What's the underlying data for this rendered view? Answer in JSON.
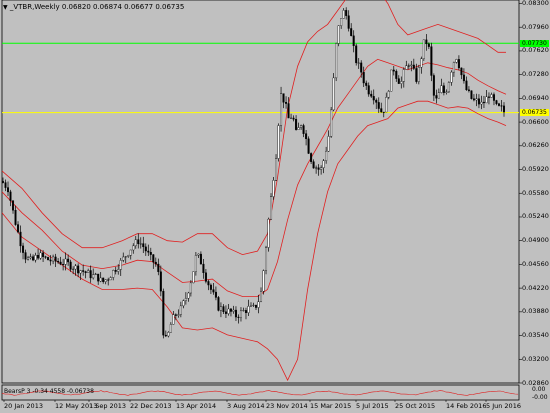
{
  "window": {
    "symbol_label": "_VTBR,Weekly",
    "ohlc": "0.06820 0.06874 0.06677 0.06735",
    "indicator_label": "BearsP 3 -0.34 4558 -0.06738",
    "indicator_ticks": [
      "0.00",
      "-0.00"
    ]
  },
  "colors": {
    "background": "#c0c0c0",
    "bollinger": "#e02020",
    "resistance_line": "#00ff00",
    "support_line": "#ffff00",
    "candles": "#000000",
    "grid": "#808080"
  },
  "price_axis": {
    "ticks": [
      "0.08300",
      "0.07960",
      "0.07620",
      "0.07280",
      "0.06940",
      "0.06600",
      "0.06260",
      "0.05920",
      "0.05580",
      "0.05240",
      "0.04900",
      "0.04560",
      "0.04220",
      "0.03880",
      "0.03540",
      "0.03200",
      "0.02860"
    ],
    "resistance_tag": "0.07730",
    "support_tag": "0.06735"
  },
  "time_axis": {
    "ticks": [
      "20 Jan 2013",
      "12 May 2013",
      "1 Sep 2013",
      "22 Dec 2013",
      "13 Apr 2014",
      "3 Aug 2014",
      "23 Nov 2014",
      "15 Mar 2015",
      "5 Jul 2015",
      "25 Oct 2015",
      "14 Feb 2016",
      "5 Jun 2016"
    ]
  },
  "chart_data": {
    "type": "candlestick",
    "title": "_VTBR,Weekly",
    "ylim": [
      0.0286,
      0.0835
    ],
    "horizontal_lines": [
      {
        "name": "resistance",
        "value": 0.0773,
        "color": "#00ff00"
      },
      {
        "name": "support",
        "value": 0.06735,
        "color": "#ffff00"
      }
    ],
    "close_path": [
      [
        0,
        0.0575
      ],
      [
        6,
        0.0565
      ],
      [
        12,
        0.0525
      ],
      [
        18,
        0.049
      ],
      [
        24,
        0.0465
      ],
      [
        30,
        0.046
      ],
      [
        36,
        0.047
      ],
      [
        42,
        0.0465
      ],
      [
        48,
        0.0462
      ],
      [
        56,
        0.046
      ],
      [
        64,
        0.0458
      ],
      [
        72,
        0.0452
      ],
      [
        80,
        0.0447
      ],
      [
        88,
        0.0441
      ],
      [
        96,
        0.0437
      ],
      [
        100,
        0.043
      ],
      [
        106,
        0.0437
      ],
      [
        112,
        0.0448
      ],
      [
        118,
        0.0458
      ],
      [
        124,
        0.047
      ],
      [
        130,
        0.0482
      ],
      [
        136,
        0.049
      ],
      [
        142,
        0.048
      ],
      [
        148,
        0.0465
      ],
      [
        154,
        0.0455
      ],
      [
        158,
        0.043
      ],
      [
        161,
        0.036
      ],
      [
        164,
        0.0345
      ],
      [
        168,
        0.0368
      ],
      [
        172,
        0.0382
      ],
      [
        178,
        0.039
      ],
      [
        184,
        0.041
      ],
      [
        190,
        0.044
      ],
      [
        194,
        0.047
      ],
      [
        198,
        0.0462
      ],
      [
        204,
        0.0435
      ],
      [
        210,
        0.0415
      ],
      [
        216,
        0.0395
      ],
      [
        222,
        0.039
      ],
      [
        228,
        0.0388
      ],
      [
        234,
        0.0382
      ],
      [
        240,
        0.0388
      ],
      [
        246,
        0.0393
      ],
      [
        252,
        0.0393
      ],
      [
        258,
        0.041
      ],
      [
        262,
        0.046
      ],
      [
        266,
        0.052
      ],
      [
        270,
        0.057
      ],
      [
        274,
        0.062
      ],
      [
        278,
        0.07
      ],
      [
        282,
        0.069
      ],
      [
        286,
        0.0665
      ],
      [
        290,
        0.067
      ],
      [
        294,
        0.064
      ],
      [
        298,
        0.066
      ],
      [
        302,
        0.0645
      ],
      [
        306,
        0.062
      ],
      [
        310,
        0.06
      ],
      [
        314,
        0.0595
      ],
      [
        318,
        0.059
      ],
      [
        322,
        0.061
      ],
      [
        326,
        0.064
      ],
      [
        330,
        0.07
      ],
      [
        334,
        0.078
      ],
      [
        338,
        0.081
      ],
      [
        342,
        0.082
      ],
      [
        346,
        0.08
      ],
      [
        350,
        0.077
      ],
      [
        354,
        0.0745
      ],
      [
        358,
        0.0735
      ],
      [
        362,
        0.0715
      ],
      [
        366,
        0.0705
      ],
      [
        370,
        0.07
      ],
      [
        374,
        0.069
      ],
      [
        378,
        0.0675
      ],
      [
        382,
        0.068
      ],
      [
        386,
        0.071
      ],
      [
        390,
        0.074
      ],
      [
        394,
        0.0725
      ],
      [
        398,
        0.0715
      ],
      [
        402,
        0.0735
      ],
      [
        406,
        0.0745
      ],
      [
        410,
        0.0735
      ],
      [
        414,
        0.072
      ],
      [
        418,
        0.075
      ],
      [
        422,
        0.078
      ],
      [
        426,
        0.0765
      ],
      [
        430,
        0.07
      ],
      [
        434,
        0.069
      ],
      [
        438,
        0.071
      ],
      [
        442,
        0.07
      ],
      [
        446,
        0.072
      ],
      [
        450,
        0.0745
      ],
      [
        454,
        0.0755
      ],
      [
        458,
        0.073
      ],
      [
        462,
        0.071
      ],
      [
        466,
        0.07
      ],
      [
        470,
        0.069
      ],
      [
        474,
        0.069
      ],
      [
        478,
        0.0685
      ],
      [
        482,
        0.069
      ],
      [
        486,
        0.07
      ],
      [
        490,
        0.069
      ],
      [
        494,
        0.068
      ],
      [
        498,
        0.068
      ],
      [
        502,
        0.0673
      ]
    ],
    "bollinger_upper": [
      [
        0,
        0.059
      ],
      [
        20,
        0.0565
      ],
      [
        40,
        0.053
      ],
      [
        60,
        0.05
      ],
      [
        80,
        0.048
      ],
      [
        100,
        0.048
      ],
      [
        120,
        0.049
      ],
      [
        135,
        0.05
      ],
      [
        150,
        0.05
      ],
      [
        165,
        0.049
      ],
      [
        180,
        0.0488
      ],
      [
        195,
        0.05
      ],
      [
        210,
        0.05
      ],
      [
        225,
        0.048
      ],
      [
        240,
        0.047
      ],
      [
        255,
        0.0475
      ],
      [
        265,
        0.05
      ],
      [
        275,
        0.058
      ],
      [
        285,
        0.068
      ],
      [
        295,
        0.074
      ],
      [
        305,
        0.0775
      ],
      [
        315,
        0.079
      ],
      [
        325,
        0.08
      ],
      [
        335,
        0.082
      ],
      [
        345,
        0.084
      ],
      [
        355,
        0.085
      ],
      [
        365,
        0.0855
      ],
      [
        375,
        0.085
      ],
      [
        385,
        0.083
      ],
      [
        395,
        0.08
      ],
      [
        405,
        0.0785
      ],
      [
        415,
        0.079
      ],
      [
        425,
        0.0795
      ],
      [
        435,
        0.08
      ],
      [
        445,
        0.0795
      ],
      [
        455,
        0.079
      ],
      [
        465,
        0.0785
      ],
      [
        475,
        0.078
      ],
      [
        485,
        0.077
      ],
      [
        495,
        0.076
      ],
      [
        503,
        0.076
      ]
    ],
    "bollinger_middle": [
      [
        0,
        0.056
      ],
      [
        20,
        0.053
      ],
      [
        40,
        0.0505
      ],
      [
        60,
        0.0475
      ],
      [
        80,
        0.0455
      ],
      [
        100,
        0.045
      ],
      [
        120,
        0.0455
      ],
      [
        135,
        0.0462
      ],
      [
        150,
        0.046
      ],
      [
        165,
        0.0445
      ],
      [
        180,
        0.043
      ],
      [
        195,
        0.0432
      ],
      [
        210,
        0.0435
      ],
      [
        225,
        0.0418
      ],
      [
        240,
        0.041
      ],
      [
        255,
        0.041
      ],
      [
        265,
        0.042
      ],
      [
        275,
        0.046
      ],
      [
        285,
        0.052
      ],
      [
        295,
        0.057
      ],
      [
        305,
        0.06
      ],
      [
        315,
        0.0625
      ],
      [
        325,
        0.065
      ],
      [
        335,
        0.068
      ],
      [
        345,
        0.07
      ],
      [
        355,
        0.072
      ],
      [
        365,
        0.074
      ],
      [
        375,
        0.075
      ],
      [
        385,
        0.0745
      ],
      [
        395,
        0.074
      ],
      [
        405,
        0.0735
      ],
      [
        415,
        0.074
      ],
      [
        425,
        0.0745
      ],
      [
        435,
        0.0742
      ],
      [
        445,
        0.0738
      ],
      [
        455,
        0.0735
      ],
      [
        465,
        0.073
      ],
      [
        475,
        0.072
      ],
      [
        485,
        0.0712
      ],
      [
        495,
        0.0705
      ],
      [
        503,
        0.07
      ]
    ],
    "bollinger_lower": [
      [
        0,
        0.053
      ],
      [
        20,
        0.0495
      ],
      [
        40,
        0.0475
      ],
      [
        60,
        0.0455
      ],
      [
        80,
        0.0435
      ],
      [
        100,
        0.042
      ],
      [
        120,
        0.042
      ],
      [
        135,
        0.0422
      ],
      [
        150,
        0.042
      ],
      [
        165,
        0.0395
      ],
      [
        180,
        0.0365
      ],
      [
        195,
        0.0362
      ],
      [
        210,
        0.0365
      ],
      [
        225,
        0.0355
      ],
      [
        240,
        0.035
      ],
      [
        255,
        0.0345
      ],
      [
        265,
        0.0335
      ],
      [
        275,
        0.032
      ],
      [
        285,
        0.029
      ],
      [
        295,
        0.032
      ],
      [
        305,
        0.042
      ],
      [
        315,
        0.05
      ],
      [
        325,
        0.056
      ],
      [
        335,
        0.06
      ],
      [
        345,
        0.062
      ],
      [
        355,
        0.064
      ],
      [
        365,
        0.0655
      ],
      [
        375,
        0.066
      ],
      [
        385,
        0.0665
      ],
      [
        395,
        0.068
      ],
      [
        405,
        0.0685
      ],
      [
        415,
        0.069
      ],
      [
        425,
        0.069
      ],
      [
        435,
        0.0685
      ],
      [
        445,
        0.068
      ],
      [
        455,
        0.0682
      ],
      [
        465,
        0.068
      ],
      [
        475,
        0.0672
      ],
      [
        485,
        0.0665
      ],
      [
        495,
        0.066
      ],
      [
        503,
        0.0655
      ]
    ]
  }
}
